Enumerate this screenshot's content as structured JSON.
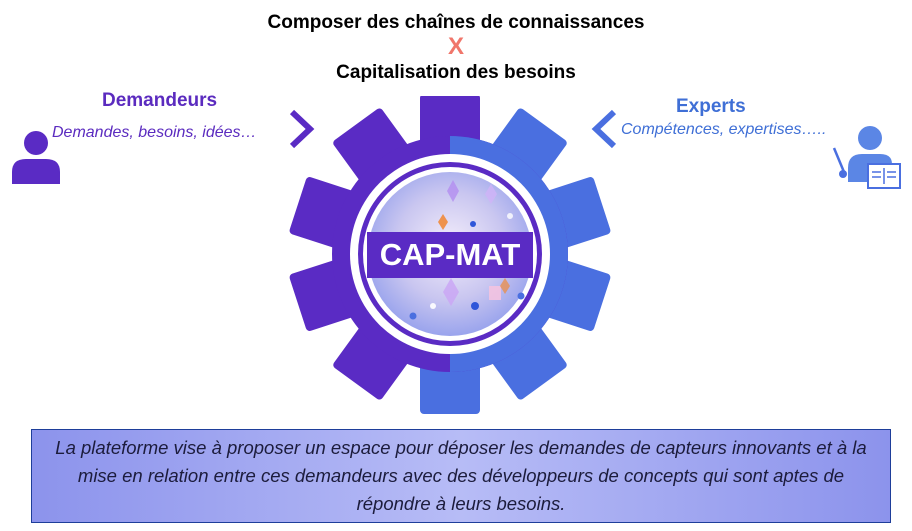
{
  "title": {
    "line1": "Composer des chaînes de connaissances",
    "separator": "X",
    "line2": "Capitalisation des besoins"
  },
  "left": {
    "title": "Demandeurs",
    "subtitle": "Demandes, besoins, idées…",
    "icon": "user-icon",
    "arrow": "chevron-right-icon"
  },
  "right": {
    "title": "Experts",
    "subtitle": "Compétences, expertises…..",
    "icon": "teacher-icon",
    "arrow": "chevron-left-icon"
  },
  "center": {
    "label": "CAP-MAT",
    "icon": "gear-icon"
  },
  "description": "La plateforme vise à proposer un espace pour déposer les demandes de capteurs innovants et à la mise en relation entre ces demandeurs avec des développeurs de concepts qui sont aptes de répondre à leurs besoins.",
  "colors": {
    "purple": "#5a2bc4",
    "blue": "#4a6fe0",
    "separator": "#f0766b",
    "box_fill": "#a3a8f0"
  }
}
